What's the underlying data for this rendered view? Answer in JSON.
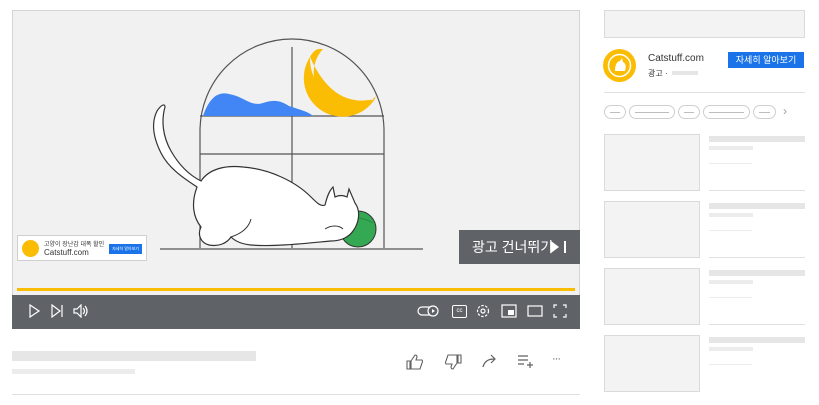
{
  "player": {
    "companion_ad": {
      "headline": "고양이 장난감 대폭 할인",
      "domain": "Catstuff.com",
      "button_label": "자세히 알아보기"
    },
    "skip_label": "광고 건너뛰기",
    "progress_fraction": 1.0,
    "controls": [
      "play-icon",
      "next-icon",
      "volume-icon",
      "autoplay-toggle-icon",
      "captions-icon",
      "settings-icon",
      "miniplayer-icon",
      "theater-icon",
      "fullscreen-icon"
    ],
    "captions_glyph": "cc"
  },
  "actions": [
    "like-icon",
    "dislike-icon",
    "share-icon",
    "save-to-playlist-icon",
    "more-icon"
  ],
  "more_glyph": "···",
  "sidebar": {
    "ad": {
      "title": "Catstuff.com",
      "sponsored": "광고 ·",
      "cta": "자세히 알아보기"
    },
    "chip_next_glyph": "›"
  },
  "colors": {
    "accent_yellow": "#fbbc04",
    "accent_blue": "#1a73e8",
    "control_bar": "#5f6368",
    "green_ball": "#34a853",
    "cloud_blue": "#4285f4"
  }
}
